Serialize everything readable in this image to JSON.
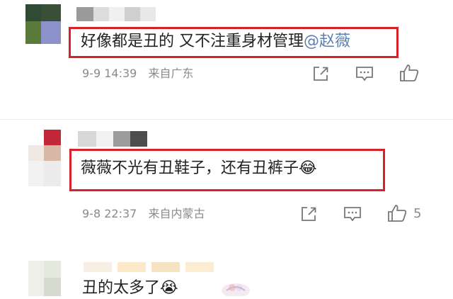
{
  "comments": [
    {
      "text": "好像都是丑的 又不注重身材管理",
      "mention": "@赵薇",
      "date": "9-9 14:39",
      "location": "来自广东",
      "like_count": ""
    },
    {
      "text": "薇薇不光有丑鞋子，还有丑裤子",
      "emoji": "😂",
      "date": "9-8 22:37",
      "location": "来自内蒙古",
      "like_count": "5"
    },
    {
      "text": "丑的太多了",
      "emoji": "😭"
    }
  ],
  "colors": {
    "highlight_box": "#d6202a",
    "mention": "#5b7fb4",
    "meta": "#8a8a8a"
  },
  "icons": [
    "share-icon",
    "comment-icon",
    "like-icon"
  ]
}
